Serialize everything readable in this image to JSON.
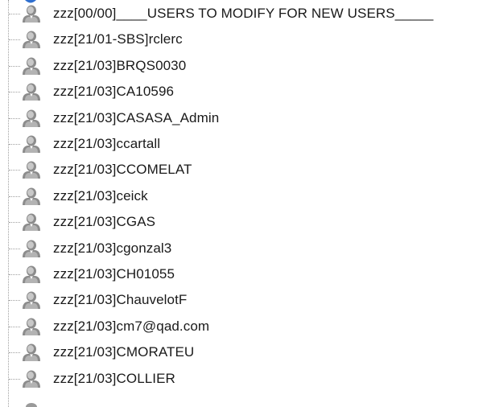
{
  "tree": {
    "items": [
      {
        "label": "zzz[00/00]____USERS TO MODIFY FOR NEW USERS_____",
        "icon": "user-icon"
      },
      {
        "label": "zzz[21/01-SBS]rclerc",
        "icon": "user-icon"
      },
      {
        "label": "zzz[21/03]BRQS0030",
        "icon": "user-icon"
      },
      {
        "label": "zzz[21/03]CA10596",
        "icon": "user-icon"
      },
      {
        "label": "zzz[21/03]CASASA_Admin",
        "icon": "user-icon"
      },
      {
        "label": "zzz[21/03]ccartall",
        "icon": "user-icon"
      },
      {
        "label": "zzz[21/03]CCOMELAT",
        "icon": "user-icon"
      },
      {
        "label": "zzz[21/03]ceick",
        "icon": "user-icon"
      },
      {
        "label": "zzz[21/03]CGAS",
        "icon": "user-icon"
      },
      {
        "label": "zzz[21/03]cgonzal3",
        "icon": "user-icon"
      },
      {
        "label": "zzz[21/03]CH01055",
        "icon": "user-icon"
      },
      {
        "label": "zzz[21/03]ChauvelotF",
        "icon": "user-icon"
      },
      {
        "label": "zzz[21/03]cm7@qad.com",
        "icon": "user-icon"
      },
      {
        "label": "zzz[21/03]CMORATEU",
        "icon": "user-icon"
      },
      {
        "label": "zzz[21/03]COLLIER",
        "icon": "user-icon"
      }
    ]
  },
  "colors": {
    "text": "#1a1a1a",
    "icon_body": "#8c8c8c",
    "icon_highlight": "#c8c8c8",
    "selection_accent": "#2f6fcf",
    "connector": "#a0a0a0"
  }
}
